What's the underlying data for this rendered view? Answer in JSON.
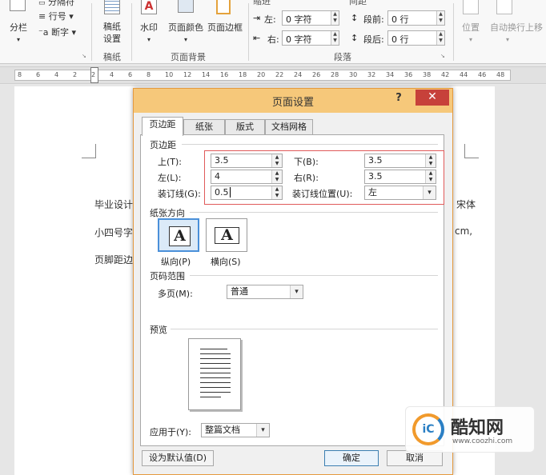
{
  "ribbon": {
    "left_buttons": {
      "columns": "分栏",
      "line_numbers": "行号",
      "hyphenation": "断字",
      "breaks_partial": "分隔符"
    },
    "manuscript": {
      "label": "稿纸设置",
      "label_line1": "稿纸",
      "label_line2": "设置",
      "group": "稿纸"
    },
    "page_background": {
      "watermark": "水印",
      "page_color": "页面颜色",
      "page_borders": "页面边框",
      "group": "页面背景"
    },
    "paragraph": {
      "indent_header": "缩进",
      "spacing_header": "间距",
      "indent_left_label": "左:",
      "indent_left_value": "0 字符",
      "indent_right_label": "右:",
      "indent_right_value": "0 字符",
      "spacing_before_label": "段前:",
      "spacing_before_value": "0 行",
      "spacing_after_label": "段后:",
      "spacing_after_value": "0 行",
      "group": "段落"
    },
    "arrange": {
      "position": "位置",
      "wrap_text": "自动换行",
      "bring_forward": "上移"
    }
  },
  "ruler": {
    "ticks": [
      "8",
      "6",
      "4",
      "2",
      "2",
      "4",
      "6",
      "8",
      "10",
      "12",
      "14",
      "16",
      "18",
      "20",
      "22",
      "24",
      "26",
      "28",
      "30",
      "32",
      "34",
      "36",
      "38",
      "42",
      "44",
      "46",
      "48"
    ]
  },
  "document": {
    "line1_start": "毕业设计",
    "line1_end": "宋体",
    "line2_start": "小四号字",
    "line2_end": "cm,",
    "line3_start": "页脚距边"
  },
  "dialog": {
    "title": "页面设置",
    "help": "?",
    "close": "✕",
    "tabs": [
      "页边距",
      "纸张",
      "版式",
      "文档网格"
    ],
    "margins": {
      "section": "页边距",
      "top_label": "上(T):",
      "top_value": "3.5",
      "bottom_label": "下(B):",
      "bottom_value": "3.5",
      "left_label": "左(L):",
      "left_value": "4",
      "right_label": "右(R):",
      "right_value": "3.5",
      "gutter_label": "装订线(G):",
      "gutter_value": "0.5",
      "gutter_pos_label": "装订线位置(U):",
      "gutter_pos_value": "左"
    },
    "orientation": {
      "section": "纸张方向",
      "portrait_glyph": "A",
      "landscape_glyph": "A",
      "portrait_label": "纵向(P)",
      "landscape_label": "横向(S)"
    },
    "pages": {
      "section": "页码范围",
      "multiple_label": "多页(M):",
      "multiple_value": "普通"
    },
    "preview": {
      "section": "预览"
    },
    "apply_to": {
      "label": "应用于(Y):",
      "value": "整篇文档"
    },
    "buttons": {
      "set_default": "设为默认值(D)",
      "ok": "确定",
      "cancel": "取消"
    }
  },
  "watermark": {
    "brand": "酷知网",
    "url": "www.coozhi.com",
    "logo_glyph": "iC"
  },
  "colors": {
    "title_bar": "#f6c87a",
    "close_button": "#c7413a",
    "highlight_box": "#e05a5a",
    "selected_orient": "#4a90d9",
    "logo_orange": "#f19a2c",
    "logo_blue": "#2a7fc4"
  }
}
